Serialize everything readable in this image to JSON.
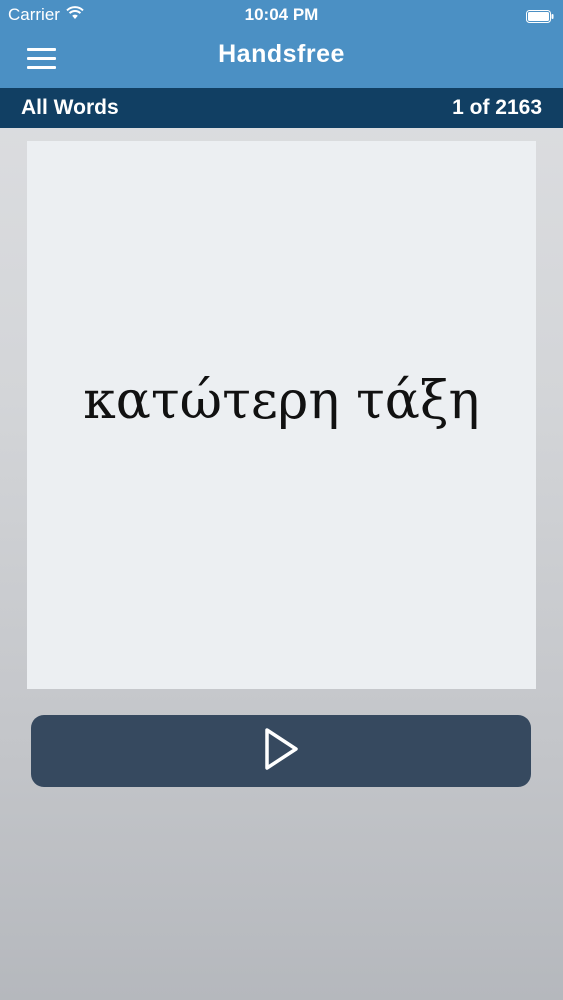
{
  "status_bar": {
    "carrier": "Carrier",
    "time": "10:04 PM",
    "wifi_icon": "wifi-icon",
    "battery_icon": "battery-icon"
  },
  "nav": {
    "title": "Handsfree",
    "menu_icon": "hamburger-menu-icon"
  },
  "subheader": {
    "list_name": "All Words",
    "position": "1 of 2163"
  },
  "card": {
    "word": "κατώτερη τάξη"
  },
  "controls": {
    "play_icon": "play-icon"
  },
  "colors": {
    "nav_bar": "#4b90c4",
    "sub_bar": "#113f63",
    "card": "#eceff2",
    "play_button": "#36495f"
  }
}
